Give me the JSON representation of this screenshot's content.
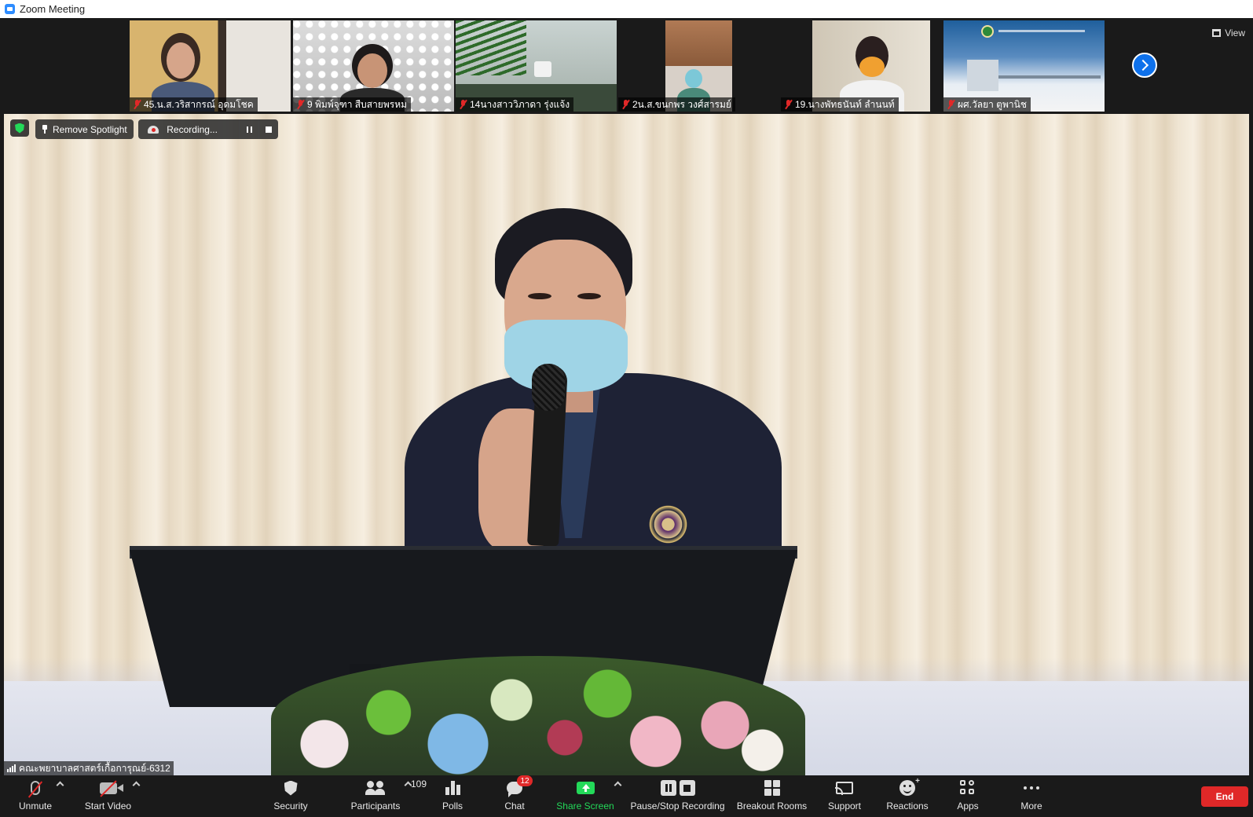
{
  "window": {
    "title": "Zoom Meeting"
  },
  "filmstrip": {
    "view_label": "View",
    "participants": [
      {
        "name": "45.น.ส.วริสากรณ์ อุดมโชค",
        "muted": true
      },
      {
        "name": "9 พิมพ์จุฑา สืบสายพรหม",
        "muted": true
      },
      {
        "name": "14นางสาววิภาดา รุ่งแจ้ง",
        "muted": true
      },
      {
        "name": "2น.ส.ขนกพร วงศ์สารมย์",
        "muted": true
      },
      {
        "name": "19.นางพัทธนันท์ ลำนนท์",
        "muted": true
      },
      {
        "name": "ผศ.วัลยา ตูพานิช",
        "muted": true
      }
    ]
  },
  "main": {
    "spotlight_label": "Remove Spotlight",
    "recording_label": "Recording...",
    "active_speaker": "คณะพยาบาลศาสตร์เกื้อการุณย์-6312"
  },
  "toolbar": {
    "unmute": "Unmute",
    "start_video": "Start Video",
    "security": "Security",
    "participants": "Participants",
    "participants_count": "109",
    "polls": "Polls",
    "chat": "Chat",
    "chat_badge": "12",
    "share_screen": "Share Screen",
    "pause_stop_recording": "Pause/Stop Recording",
    "breakout_rooms": "Breakout Rooms",
    "support": "Support",
    "reactions": "Reactions",
    "apps": "Apps",
    "more": "More",
    "end": "End"
  },
  "colors": {
    "accent": "#0e71eb",
    "share_green": "#23d959",
    "end_red": "#e02828",
    "toolbar_bg": "#1a1a1a"
  }
}
